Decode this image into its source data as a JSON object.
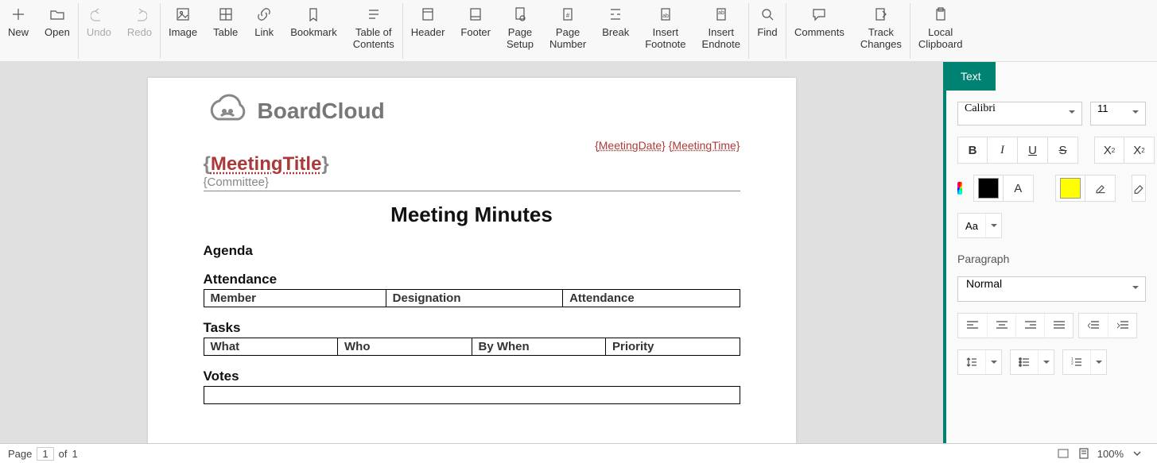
{
  "ribbon": {
    "new": "New",
    "open": "Open",
    "undo": "Undo",
    "redo": "Redo",
    "image": "Image",
    "table": "Table",
    "link": "Link",
    "bookmark": "Bookmark",
    "toc": "Table of\nContents",
    "header": "Header",
    "footer": "Footer",
    "page_setup": "Page\nSetup",
    "page_number": "Page\nNumber",
    "break": "Break",
    "insert_footnote": "Insert\nFootnote",
    "insert_endnote": "Insert\nEndnote",
    "find": "Find",
    "comments": "Comments",
    "track_changes": "Track\nChanges",
    "local_clipboard": "Local\nClipboard"
  },
  "doc": {
    "logo_text": "BoardCloud",
    "meeting_date": "MeetingDate",
    "meeting_time": "MeetingTime",
    "title_tok": "MeetingTitle",
    "committee_tok": "{Committee}",
    "heading": "Meeting Minutes",
    "agenda": "Agenda",
    "attendance": "Attendance",
    "attendance_cols": {
      "c1": "Member",
      "c2": "Designation",
      "c3": "Attendance"
    },
    "tasks": "Tasks",
    "tasks_cols": {
      "c1": "What",
      "c2": "Who",
      "c3": "By When",
      "c4": "Priority"
    },
    "votes": "Votes"
  },
  "panel": {
    "tab": "Text",
    "font": "Calibri",
    "size": "11",
    "font_color": "#000000",
    "highlight_color": "#ffff00",
    "btn_B": "B",
    "btn_I": "I",
    "btn_U": "U",
    "btn_S": "S",
    "btn_sup": "X",
    "btn_sub": "X",
    "btn_A": "A",
    "btn_Aa": "Aa",
    "para_label": "Paragraph",
    "para_style": "Normal"
  },
  "status": {
    "page_label": "Page",
    "page_num": "1",
    "of": "of",
    "page_total": "1",
    "zoom": "100%"
  }
}
